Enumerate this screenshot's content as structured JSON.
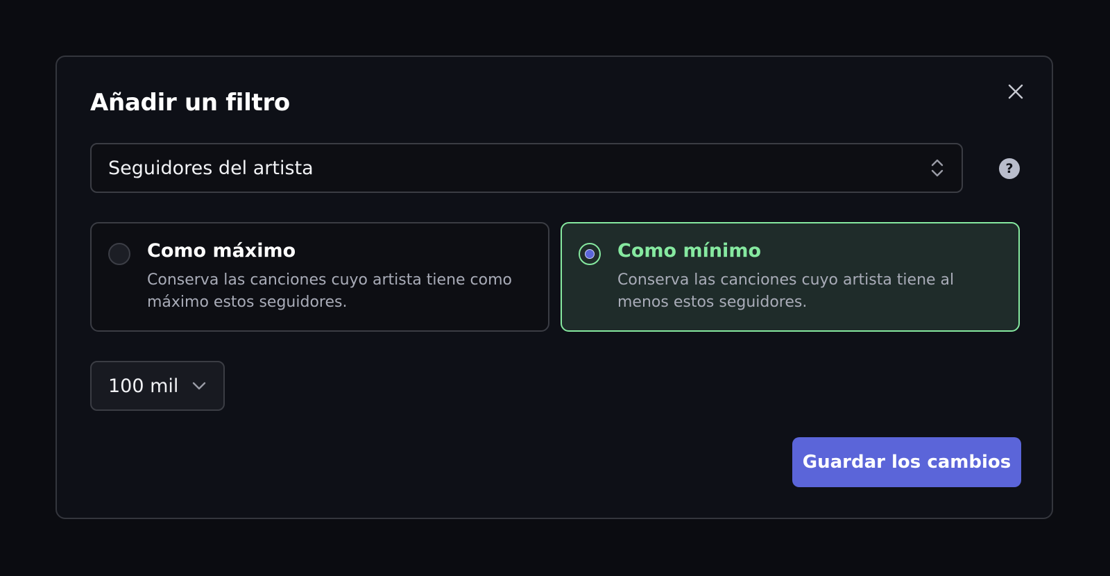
{
  "dialog": {
    "title": "Añadir un filtro",
    "close_icon": "close-icon"
  },
  "filter_select": {
    "value": "Seguidores del artista",
    "icon": "chevron-up-down-icon"
  },
  "help": {
    "icon": "question-mark-icon",
    "glyph": "?"
  },
  "options": [
    {
      "label": "Como máximo",
      "description": "Conserva las canciones cuyo artista tiene como máximo estos seguidores.",
      "selected": false
    },
    {
      "label": "Como mínimo",
      "description": "Conserva las canciones cuyo artista tiene al menos estos seguidores.",
      "selected": true
    }
  ],
  "amount_select": {
    "value": "100 mil",
    "icon": "chevron-down-icon"
  },
  "save_button": {
    "label": "Guardar los cambios"
  },
  "colors": {
    "background": "#0b0c11",
    "modal": "#0e1017",
    "accent": "#5b65d9",
    "selected_border": "#86e9a0",
    "selected_bg": "#1f2c2a"
  }
}
